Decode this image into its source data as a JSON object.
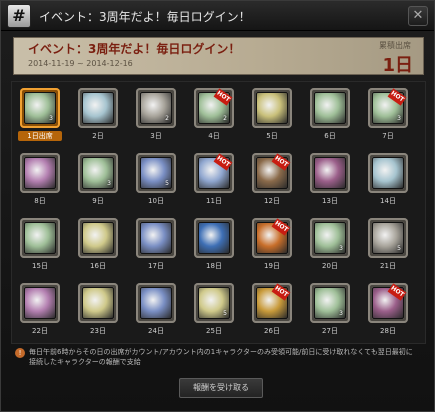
{
  "window": {
    "icon_glyph": "#",
    "title": "イベント：3周年だよ！毎日ログイン！",
    "close_glyph": "✕"
  },
  "banner": {
    "title": "イベント：3周年だよ！毎日ログイン！",
    "dates": "2014-11-19 ~ 2014-12-16",
    "count_label": "累積出席",
    "count_value": "1日"
  },
  "days": [
    {
      "label": "1日出席",
      "claimed": true,
      "hot": false,
      "qty": "3",
      "color": "#9fbf98",
      "icon": "potion-box-icon"
    },
    {
      "label": "2日",
      "claimed": false,
      "hot": false,
      "qty": "",
      "color": "#a6c4cf",
      "icon": "angel-statue-icon"
    },
    {
      "label": "3日",
      "claimed": false,
      "hot": false,
      "qty": "2",
      "color": "#a8a49b",
      "icon": "scroll-icon"
    },
    {
      "label": "4日",
      "claimed": false,
      "hot": true,
      "qty": "2",
      "color": "#9fbf98",
      "icon": "potion-box-icon"
    },
    {
      "label": "5日",
      "claimed": false,
      "hot": false,
      "qty": "",
      "color": "#c9c07a",
      "icon": "golden-statue-icon"
    },
    {
      "label": "6日",
      "claimed": false,
      "hot": false,
      "qty": "",
      "color": "#9fbf98",
      "icon": "potion-box-icon"
    },
    {
      "label": "7日",
      "claimed": false,
      "hot": true,
      "qty": "3",
      "color": "#9fbf98",
      "icon": "potion-box-icon"
    },
    {
      "label": "8日",
      "claimed": false,
      "hot": false,
      "qty": "",
      "color": "#b37fb0",
      "icon": "pink-potion-icon"
    },
    {
      "label": "9日",
      "claimed": false,
      "hot": false,
      "qty": "3",
      "color": "#9fbf98",
      "icon": "potion-box-icon"
    },
    {
      "label": "10日",
      "claimed": false,
      "hot": false,
      "qty": "5",
      "color": "#7a8fc4",
      "icon": "red-blue-capsule-icon"
    },
    {
      "label": "11日",
      "claimed": false,
      "hot": true,
      "qty": "",
      "color": "#8fa6cf",
      "icon": "crystal-cube-icon"
    },
    {
      "label": "12日",
      "claimed": false,
      "hot": true,
      "qty": "",
      "color": "#8a6a4a",
      "icon": "brown-scroll-icon"
    },
    {
      "label": "13日",
      "claimed": false,
      "hot": false,
      "qty": "",
      "color": "#9b5f8a",
      "icon": "purple-potion-icon"
    },
    {
      "label": "14日",
      "claimed": false,
      "hot": false,
      "qty": "",
      "color": "#a6c4cf",
      "icon": "angel-statue-icon"
    },
    {
      "label": "15日",
      "claimed": false,
      "hot": false,
      "qty": "",
      "color": "#9fbf98",
      "icon": "potion-box-icon"
    },
    {
      "label": "16日",
      "claimed": false,
      "hot": false,
      "qty": "",
      "color": "#cfc98a",
      "icon": "yellow-bottle-icon"
    },
    {
      "label": "17日",
      "claimed": false,
      "hot": false,
      "qty": "",
      "color": "#7a8fc4",
      "icon": "red-blue-capsule-icon"
    },
    {
      "label": "18日",
      "claimed": false,
      "hot": false,
      "qty": "",
      "color": "#3e6fb5",
      "icon": "blue-gem-icon"
    },
    {
      "label": "19日",
      "claimed": false,
      "hot": true,
      "qty": "",
      "color": "#c86e2a",
      "icon": "gift-box-icon"
    },
    {
      "label": "20日",
      "claimed": false,
      "hot": false,
      "qty": "3",
      "color": "#9fbf98",
      "icon": "potion-box-icon"
    },
    {
      "label": "21日",
      "claimed": false,
      "hot": false,
      "qty": "5",
      "color": "#a8a49b",
      "icon": "scroll-icon"
    },
    {
      "label": "22日",
      "claimed": false,
      "hot": false,
      "qty": "",
      "color": "#b37fb0",
      "icon": "pink-potion-icon"
    },
    {
      "label": "23日",
      "claimed": false,
      "hot": false,
      "qty": "",
      "color": "#cfc98a",
      "icon": "yellow-bottle-icon"
    },
    {
      "label": "24日",
      "claimed": false,
      "hot": false,
      "qty": "",
      "color": "#7a8fc4",
      "icon": "red-blue-capsule-icon"
    },
    {
      "label": "25日",
      "claimed": false,
      "hot": false,
      "qty": "5",
      "color": "#cfc98a",
      "icon": "yellow-bottle-icon"
    },
    {
      "label": "26日",
      "claimed": false,
      "hot": true,
      "qty": "",
      "color": "#c89a3a",
      "icon": "golden-box-icon"
    },
    {
      "label": "27日",
      "claimed": false,
      "hot": false,
      "qty": "3",
      "color": "#9fbf98",
      "icon": "potion-box-icon"
    },
    {
      "label": "28日",
      "claimed": false,
      "hot": true,
      "qty": "",
      "color": "#9b5f8a",
      "icon": "purple-potion-icon"
    }
  ],
  "hot_label": "HOT",
  "notice": {
    "icon_glyph": "!",
    "text": "毎日午前6時からその日の出席がカウント/アカウント内の1キャラクターのみ受領可能/前日に受け取れなくても翌日最初に接続したキャラクターの報酬で支給"
  },
  "claim_button": "報酬を受け取る"
}
